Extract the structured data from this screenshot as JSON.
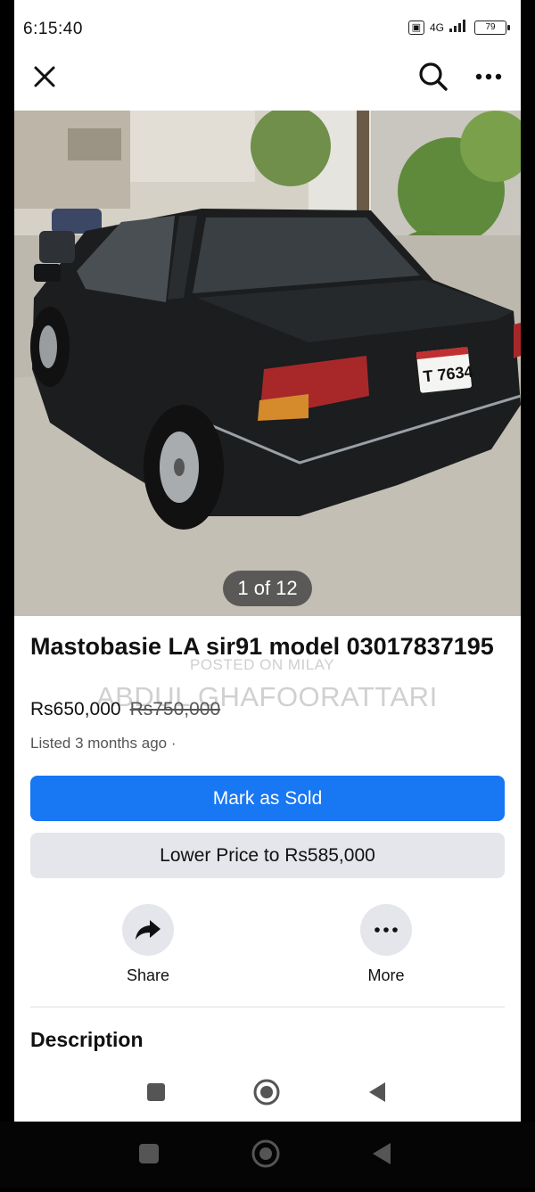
{
  "status": {
    "time": "6:15:40",
    "network_label": "4G",
    "battery": "79"
  },
  "header": {
    "close_icon": "close-icon",
    "search_icon": "search-icon",
    "more_icon": "more-horizontal-icon"
  },
  "photo": {
    "counter": "1 of 12",
    "plate": "T 7634"
  },
  "listing": {
    "title": "Mastobasie LA sir91 model 03017837195",
    "price": "Rs650,000",
    "original_price": "Rs750,000",
    "listed": "Listed 3 months ago ·"
  },
  "watermark": {
    "line1": "POSTED ON MILAY",
    "line2": "ABDUL GHAFOORATTARI"
  },
  "buttons": {
    "mark_sold": "Mark as Sold",
    "lower_price": "Lower Price to Rs585,000"
  },
  "actions": {
    "share": "Share",
    "more": "More"
  },
  "section": {
    "description": "Description"
  },
  "colors": {
    "primary": "#1877f2",
    "secondary": "#e4e6eb"
  }
}
